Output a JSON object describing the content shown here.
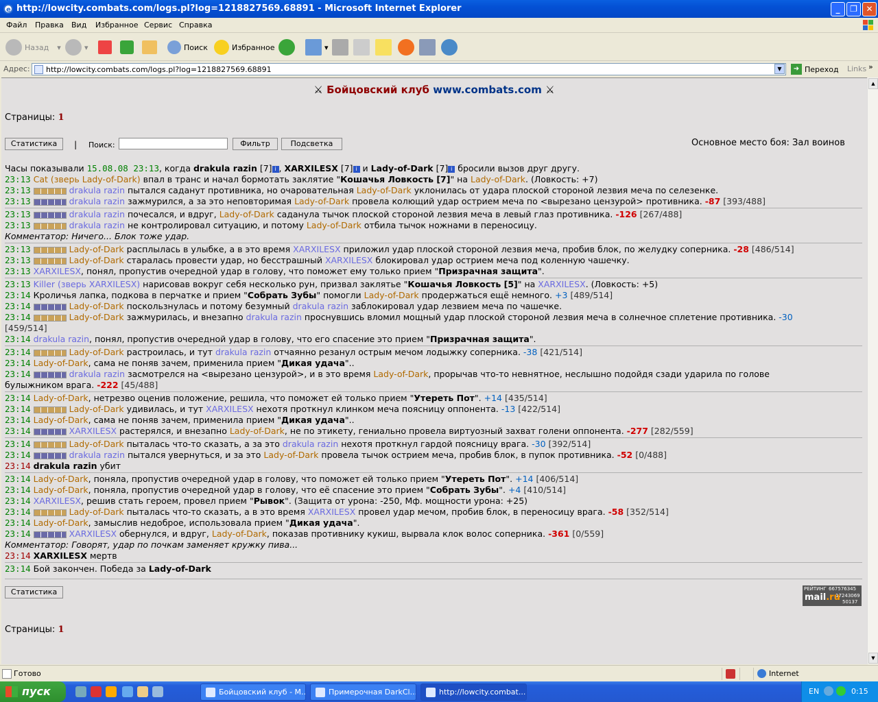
{
  "window": {
    "title": "http://lowcity.combats.com/logs.pl?log=1218827569.68891 - Microsoft Internet Explorer"
  },
  "menu": [
    "Файл",
    "Правка",
    "Вид",
    "Избранное",
    "Сервис",
    "Справка"
  ],
  "toolbar": {
    "back": "Назад",
    "search": "Поиск",
    "favorites": "Избранное"
  },
  "address": {
    "label": "Адрес:",
    "url": "http://lowcity.combats.com/logs.pl?log=1218827569.68891",
    "go": "Переход",
    "links": "Links"
  },
  "page": {
    "header_a": "Бойцовский клуб",
    "header_b": "www.combats.com",
    "pages_label": "Страницы:",
    "pages_value": "1",
    "btn_stats": "Статистика",
    "btn_filter": "Фильтр",
    "btn_highlight": "Подсветка",
    "search_label": "Поиск:",
    "pipe": "|",
    "place": "Основное место боя: Зал воинов"
  },
  "rating": {
    "label": "РЕЙТИНГ",
    "n1": "667576345",
    "n2": "17243069",
    "n3": "50137",
    "mail": "mail",
    "ru": ".ru"
  },
  "status": {
    "text": "Готово",
    "zone": "Internet"
  },
  "taskbar": {
    "start": "пуск",
    "tasks": [
      "Бойцовский клуб - М...",
      "Примерочная DarkCl...",
      "http://lowcity.combat..."
    ],
    "lang": "EN",
    "time": "0:15"
  }
}
